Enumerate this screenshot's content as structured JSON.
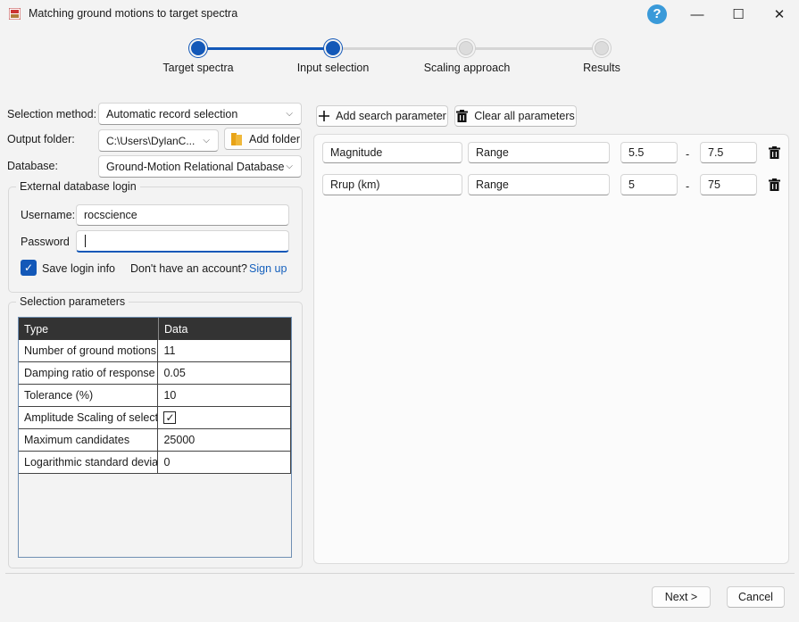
{
  "window": {
    "title": "Matching ground motions to target spectra",
    "help": "?",
    "minimize": "—",
    "maximize": "☐",
    "close": "✕"
  },
  "stepper": {
    "steps": [
      {
        "label": "Target spectra",
        "state": "done"
      },
      {
        "label": "Input selection",
        "state": "current"
      },
      {
        "label": "Scaling approach",
        "state": "todo"
      },
      {
        "label": "Results",
        "state": "todo"
      }
    ],
    "accent": "#1358b8"
  },
  "form": {
    "selection_method_label": "Selection method:",
    "selection_method_value": "Automatic record selection",
    "output_folder_label": "Output folder:",
    "output_folder_value": "C:\\Users\\DylanC...",
    "add_folder_label": "Add folder",
    "database_label": "Database:",
    "database_value": "Ground-Motion Relational Database"
  },
  "login": {
    "title": "External database login",
    "username_label": "Username:",
    "username_value": "rocscience",
    "password_label": "Password",
    "password_value": "",
    "save_login_label": "Save login info",
    "save_login_checked": true,
    "no_account_text": "Don't have an account?",
    "signup_label": "Sign up"
  },
  "selection_params": {
    "title": "Selection parameters",
    "headers": [
      "Type",
      "Data"
    ],
    "rows": [
      {
        "type": "Number of ground motions",
        "data": "11"
      },
      {
        "type": "Damping ratio of response s",
        "data": "0.05"
      },
      {
        "type": "Tolerance (%)",
        "data": "10"
      },
      {
        "type": "Amplitude Scaling of selecte",
        "data": "",
        "checkbox": true
      },
      {
        "type": "Maximum candidates",
        "data": "25000"
      },
      {
        "type": "Logarithmic standard deviati",
        "data": "0"
      }
    ]
  },
  "toolbar": {
    "add_search_label": "Add search parameter",
    "clear_all_label": "Clear all parameters"
  },
  "search_params": [
    {
      "name": "Magnitude",
      "mode": "Range",
      "min": "5.5",
      "sep": "-",
      "max": "7.5"
    },
    {
      "name": "Rrup (km)",
      "mode": "Range",
      "min": "5",
      "sep": "-",
      "max": "75"
    }
  ],
  "footer": {
    "next_label": "Next >",
    "cancel_label": "Cancel"
  }
}
